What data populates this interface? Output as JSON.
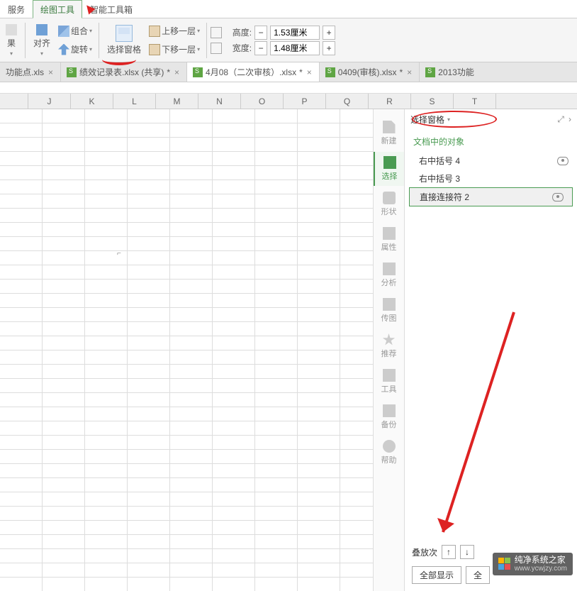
{
  "tabs": {
    "service": "服务",
    "drawing_tools": "绘图工具",
    "smart_toolbox": "智能工具箱"
  },
  "toolbar": {
    "group": "组合",
    "align": "对齐",
    "rotate": "旋转",
    "selection_pane": "选择窗格",
    "move_up": "上移一层",
    "move_down": "下移一层",
    "height_label": "高度:",
    "width_label": "宽度:",
    "height_val": "1.53厘米",
    "width_val": "1.48厘米",
    "minus": "−",
    "plus": "+",
    "result": "果"
  },
  "doc_tabs": [
    {
      "name": "功能点.xls",
      "star": "",
      "active": false
    },
    {
      "name": "绩效记录表.xlsx (共享)",
      "star": " *",
      "active": false,
      "icon": true
    },
    {
      "name": "4月08（二次审核）.xlsx",
      "star": " *",
      "active": true,
      "icon": true
    },
    {
      "name": "0409(审核).xlsx",
      "star": " *",
      "active": false,
      "icon": true
    },
    {
      "name": "2013功能",
      "star": "",
      "active": false,
      "icon": true
    }
  ],
  "columns": [
    "J",
    "K",
    "L",
    "M",
    "N",
    "O",
    "P",
    "Q",
    "R",
    "S",
    "T"
  ],
  "side": {
    "new": "新建",
    "select": "选择",
    "shape": "形状",
    "prop": "属性",
    "analyze": "分析",
    "upload": "传图",
    "recommend": "推荐",
    "tools": "工具",
    "backup": "备份",
    "help": "帮助"
  },
  "pane": {
    "title": "选择窗格",
    "section": "文档中的对象",
    "items": [
      {
        "name": "右中括号 4"
      },
      {
        "name": "右中括号 3"
      },
      {
        "name": "直接连接符 2"
      }
    ],
    "stack_label": "叠放次",
    "show_all": "全部显示",
    "show_partial": "全"
  },
  "watermark": {
    "title": "纯净系统之家",
    "url": "www.ycwjzy.com"
  }
}
